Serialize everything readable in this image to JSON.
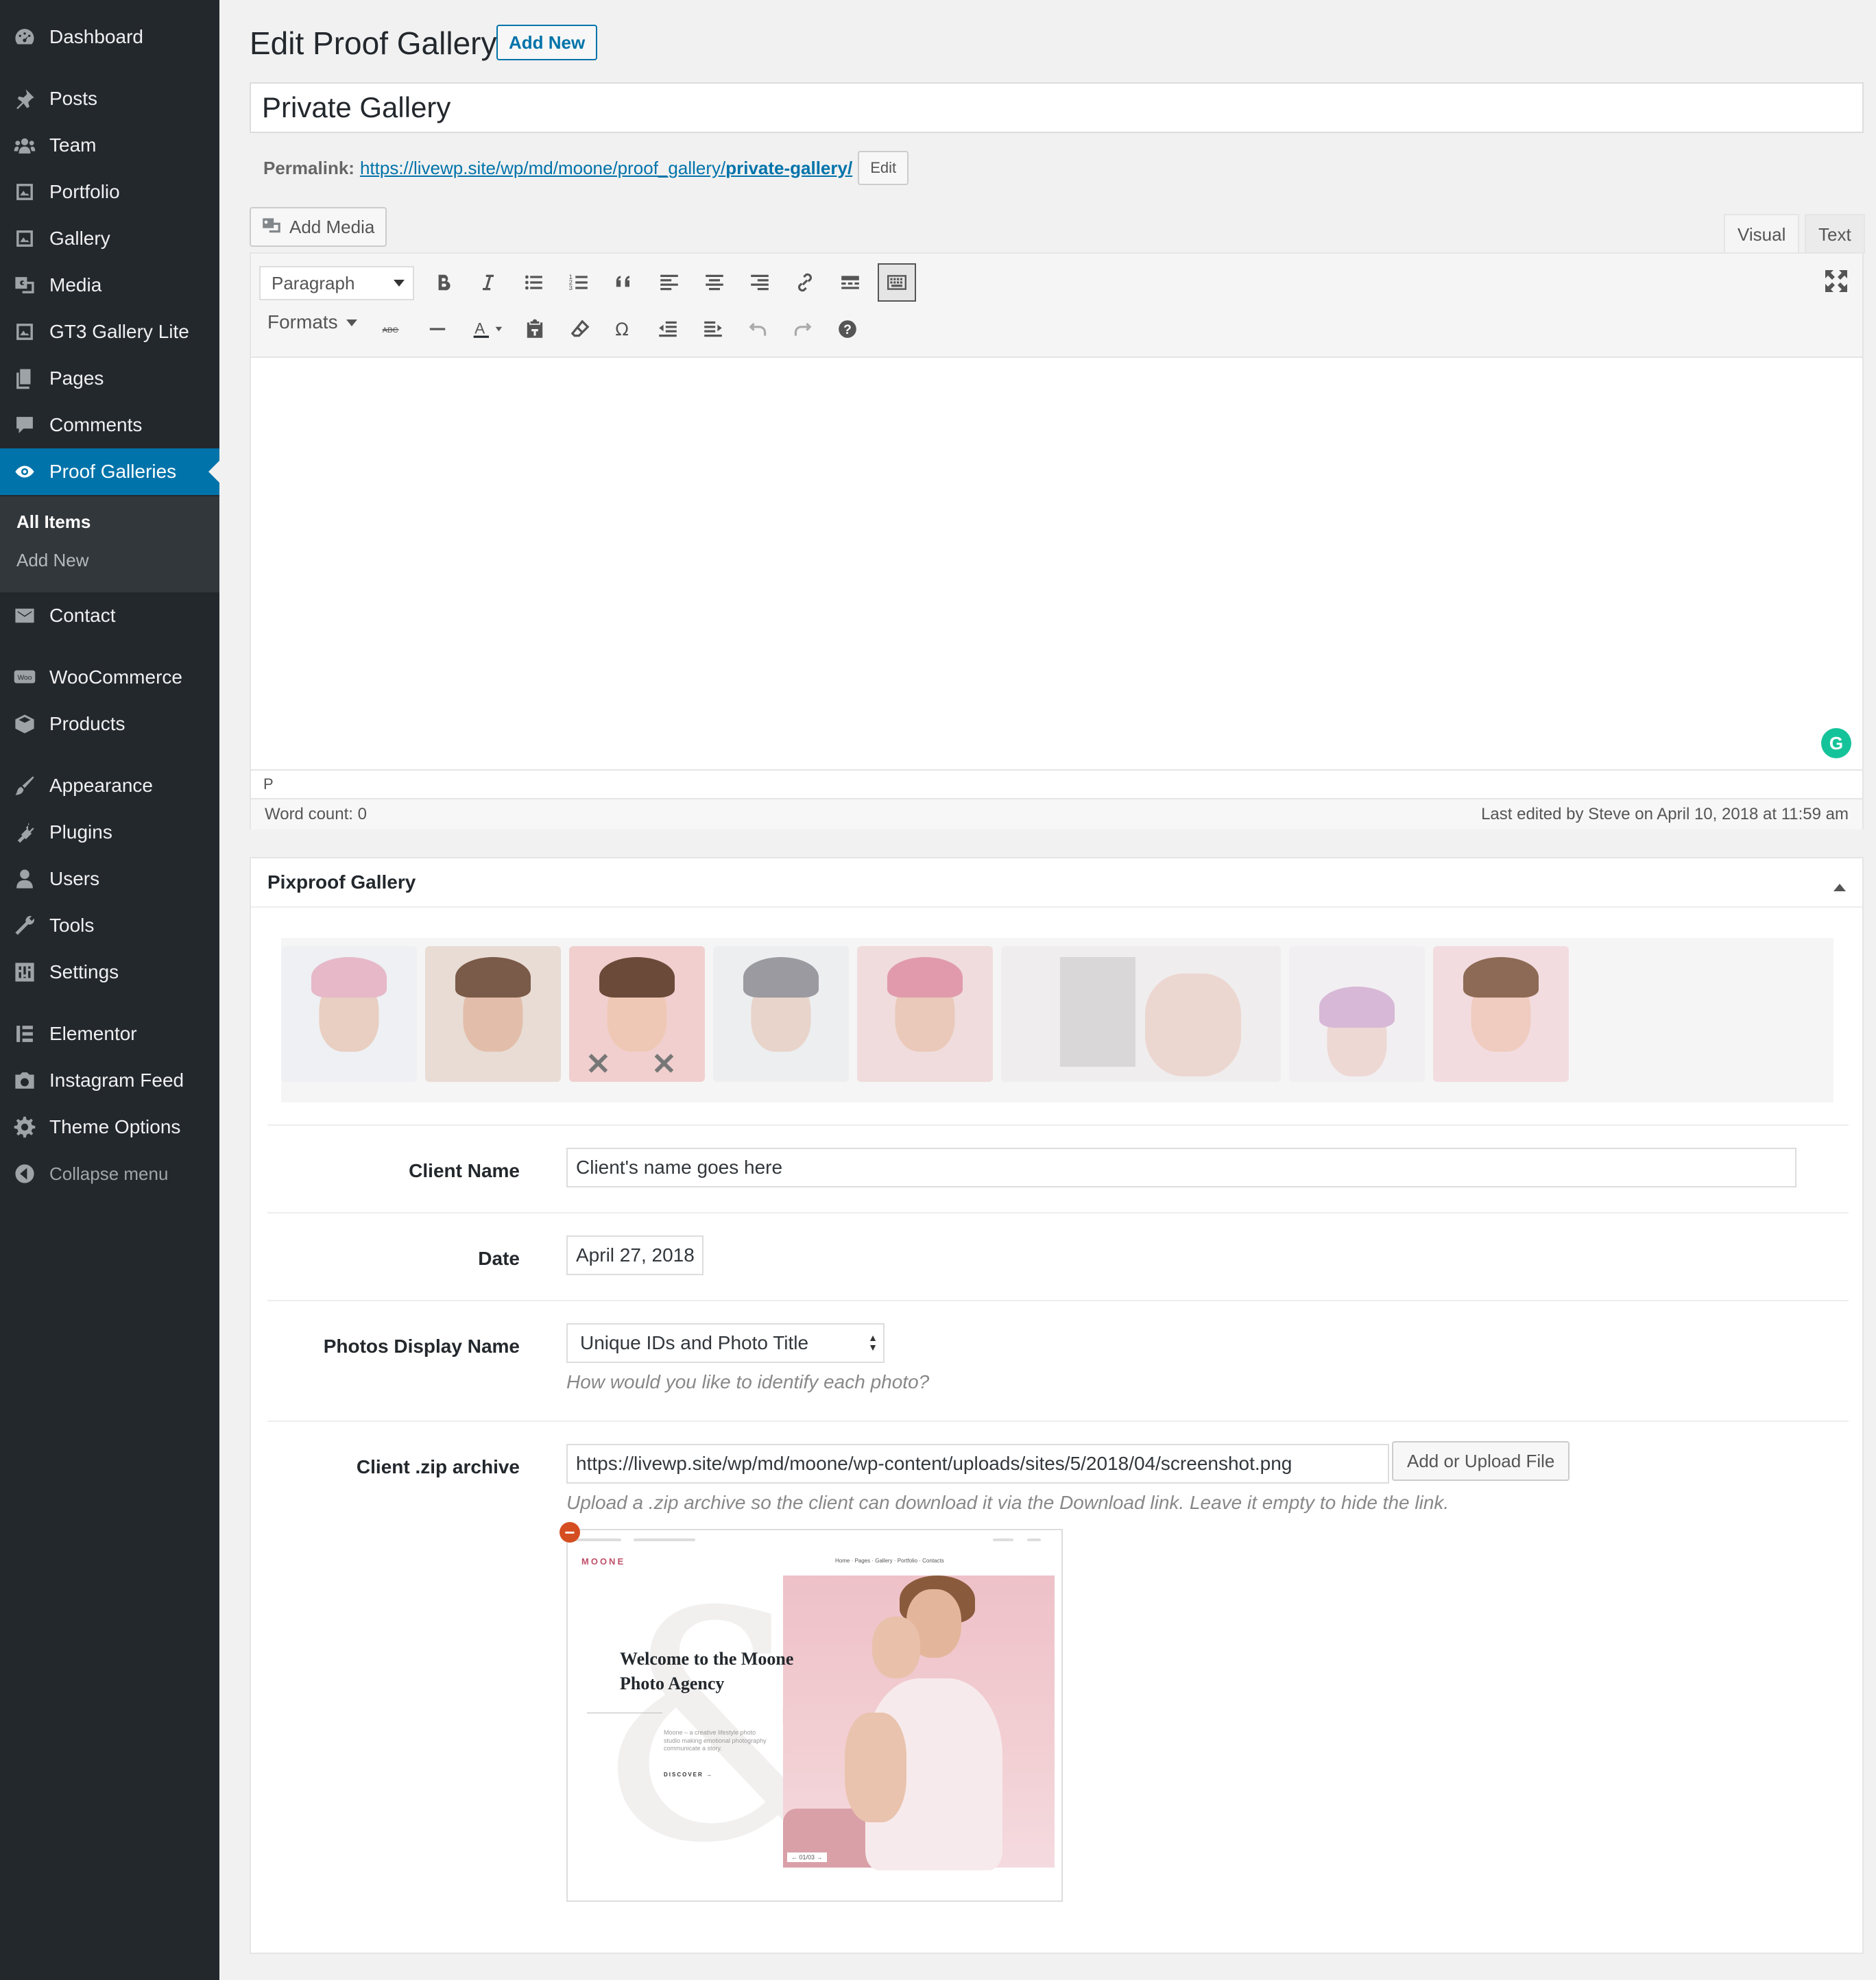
{
  "sidebar": {
    "items": [
      {
        "label": "Dashboard",
        "icon": "dashboard-icon"
      },
      {
        "label": "Posts",
        "icon": "pin-icon"
      },
      {
        "label": "Team",
        "icon": "groups-icon"
      },
      {
        "label": "Portfolio",
        "icon": "portfolio-icon"
      },
      {
        "label": "Gallery",
        "icon": "gallery-icon"
      },
      {
        "label": "Media",
        "icon": "media-icon"
      },
      {
        "label": "GT3 Gallery Lite",
        "icon": "gallery-lite-icon"
      },
      {
        "label": "Pages",
        "icon": "pages-icon"
      },
      {
        "label": "Comments",
        "icon": "comment-icon"
      },
      {
        "label": "Proof Galleries",
        "icon": "eye-icon"
      },
      {
        "label": "Contact",
        "icon": "mail-icon"
      },
      {
        "label": "WooCommerce",
        "icon": "woo-icon"
      },
      {
        "label": "Products",
        "icon": "box-icon"
      },
      {
        "label": "Appearance",
        "icon": "brush-icon"
      },
      {
        "label": "Plugins",
        "icon": "plug-icon"
      },
      {
        "label": "Users",
        "icon": "user-icon"
      },
      {
        "label": "Tools",
        "icon": "wrench-icon"
      },
      {
        "label": "Settings",
        "icon": "settings-icon"
      },
      {
        "label": "Elementor",
        "icon": "elementor-icon"
      },
      {
        "label": "Instagram Feed",
        "icon": "camera-icon"
      },
      {
        "label": "Theme Options",
        "icon": "gear-icon"
      },
      {
        "label": "Collapse menu",
        "icon": "collapse-icon"
      }
    ],
    "submenu": [
      "All Items",
      "Add New"
    ],
    "accent": "#0073aa"
  },
  "header": {
    "title": "Edit Proof Gallery",
    "add_new": "Add New"
  },
  "post": {
    "title_value": "Private Gallery",
    "permalink_label": "Permalink:",
    "permalink_base": "https://livewp.site/wp/md/moone/proof_gallery/",
    "permalink_slug": "private-gallery/",
    "edit_label": "Edit"
  },
  "editor": {
    "add_media": "Add Media",
    "tab_visual": "Visual",
    "tab_text": "Text",
    "format_select": "Paragraph",
    "formats": "Formats",
    "path": "P",
    "word_count": "Word count: 0",
    "last_edited": "Last edited by Steve on April 10, 2018 at 11:59 am",
    "grammarly": "G"
  },
  "metabox": {
    "title": "Pixproof Gallery",
    "client_name_label": "Client Name",
    "client_name_value": "Client's name goes here",
    "date_label": "Date",
    "date_value": "April 27, 2018",
    "display_label": "Photos Display Name",
    "display_value": "Unique IDs and Photo Title",
    "display_desc": "How would you like to identify each photo?",
    "zip_label": "Client .zip archive",
    "zip_value": "https://livewp.site/wp/md/moone/wp-content/uploads/sites/5/2018/04/screenshot.png",
    "upload_button": "Add or Upload File",
    "zip_desc": "Upload a .zip archive so the client can download it via the Download link. Leave it empty to hide the link.",
    "gallery_count": 9
  },
  "preview": {
    "logo": "MOONE",
    "nav": "Home ·   Pages ·   Gallery ·   Portfolio ·   Contacts",
    "heading": "Welcome to the Moone Photo Agency",
    "text": "Moone – a creative lifestyle photo studio making emotional photography communicate a story.",
    "discover": "DISCOVER →",
    "pager": "← 01/03 →"
  }
}
